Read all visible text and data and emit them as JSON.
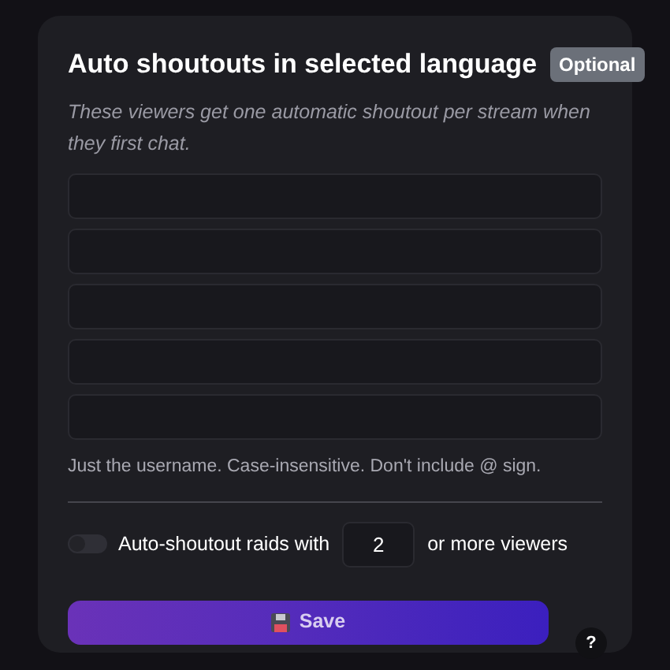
{
  "title": "Auto shoutouts in selected language",
  "badge": "Optional",
  "description": "These viewers get one automatic shoutout per stream when they first chat.",
  "username_fields": [
    {
      "kind": "text"
    },
    {
      "kind": "text"
    },
    {
      "kind": "text"
    },
    {
      "kind": "text"
    },
    {
      "kind": "text"
    }
  ],
  "hint": "Just the username. Case-insensitive. Don't include @ sign.",
  "raid": {
    "on": false,
    "label": "Auto-shoutout raids with",
    "value": "2",
    "suffix": "or more viewers"
  },
  "save_button": "Save",
  "help_button": "?"
}
